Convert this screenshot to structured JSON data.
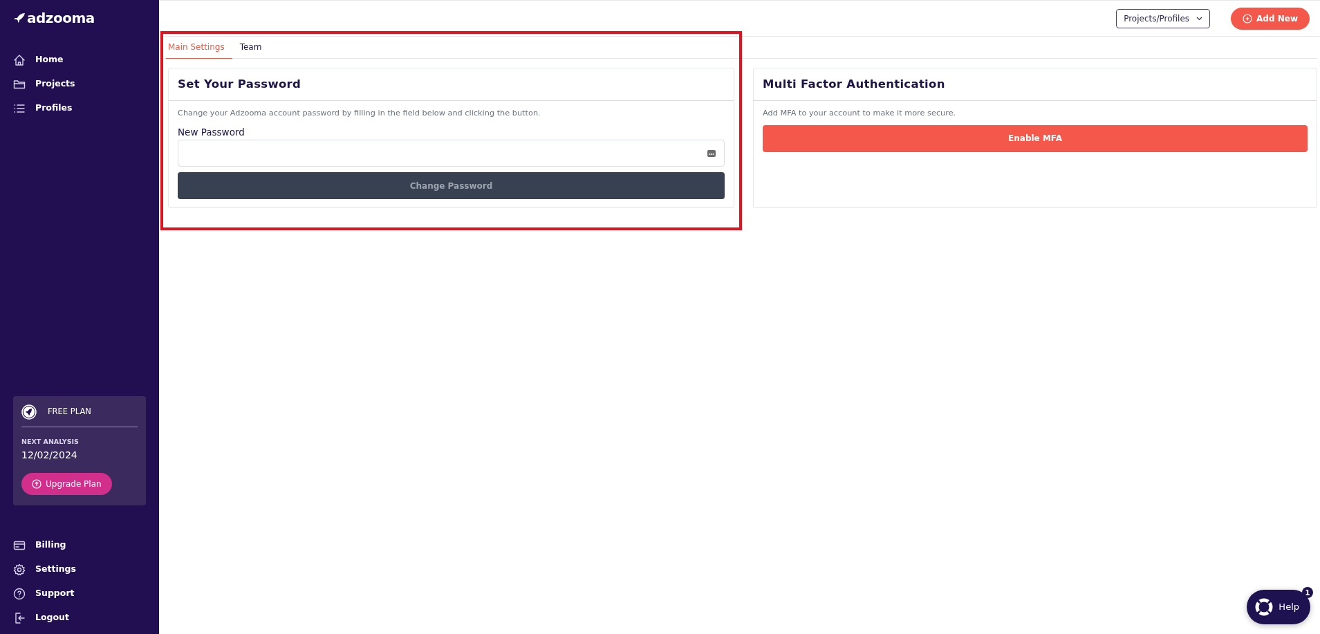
{
  "logo": {
    "text": "adzooma"
  },
  "sidebar": {
    "items": [
      {
        "label": "Home"
      },
      {
        "label": "Projects"
      },
      {
        "label": "Profiles"
      }
    ],
    "plan": {
      "name": "FREE PLAN",
      "next_label": "NEXT ANALYSIS",
      "next_date": "12/02/2024",
      "button": "Upgrade Plan"
    },
    "bottom_items": [
      {
        "label": "Billing"
      },
      {
        "label": "Settings"
      },
      {
        "label": "Support"
      },
      {
        "label": "Logout"
      }
    ]
  },
  "topbar": {
    "dropdown": "Projects/Profiles",
    "add_button": "Add New"
  },
  "tabs": [
    {
      "label": "Main Settings",
      "selected": true
    },
    {
      "label": "Team",
      "selected": false
    }
  ],
  "password_card": {
    "title": "Set Your Password",
    "text": "Change your Adzooma account password by filling in the field below and clicking the button.",
    "field_label": "New Password",
    "button": "Change Password",
    "button_disabled": true
  },
  "mfa_card": {
    "title": "Multi Factor Authentication",
    "text": "Add MFA to your account to make it more secure.",
    "button": "Enable MFA"
  },
  "help": {
    "label": "Help",
    "badge": "1"
  }
}
